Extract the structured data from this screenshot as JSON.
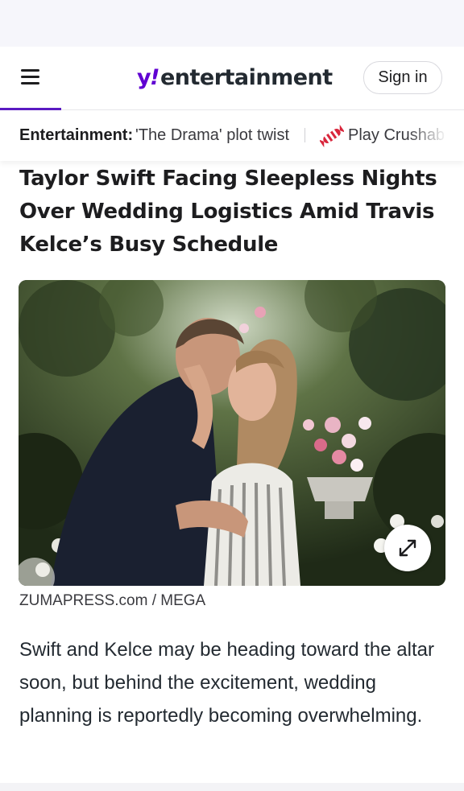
{
  "header": {
    "logo": {
      "y": "y",
      "slash": "!",
      "word": "entertainment"
    },
    "sign_in_label": "Sign in"
  },
  "ticker": {
    "label": "Entertainment:",
    "items": [
      {
        "text": "'The Drama' plot twist"
      },
      {
        "text": "Play Crushab",
        "icon": "candy-icon"
      }
    ]
  },
  "article": {
    "headline": "Taylor Swift Facing Sleepless Nights Over Wedding Logistics Amid Travis Kelce’s Busy Schedule",
    "image_credit": "ZUMAPRESS.com / MEGA",
    "summary": "Swift and Kelce may be heading toward the altar soon, but behind the excitement, wedding planning is reportedly becoming overwhelming."
  },
  "icons": {
    "menu": "hamburger-menu-icon",
    "expand": "expand-icon",
    "candy": "candy-icon"
  },
  "colors": {
    "brand": "#6001d2",
    "text": "#1d1d1f",
    "top_strip": "#f6f6fb"
  }
}
